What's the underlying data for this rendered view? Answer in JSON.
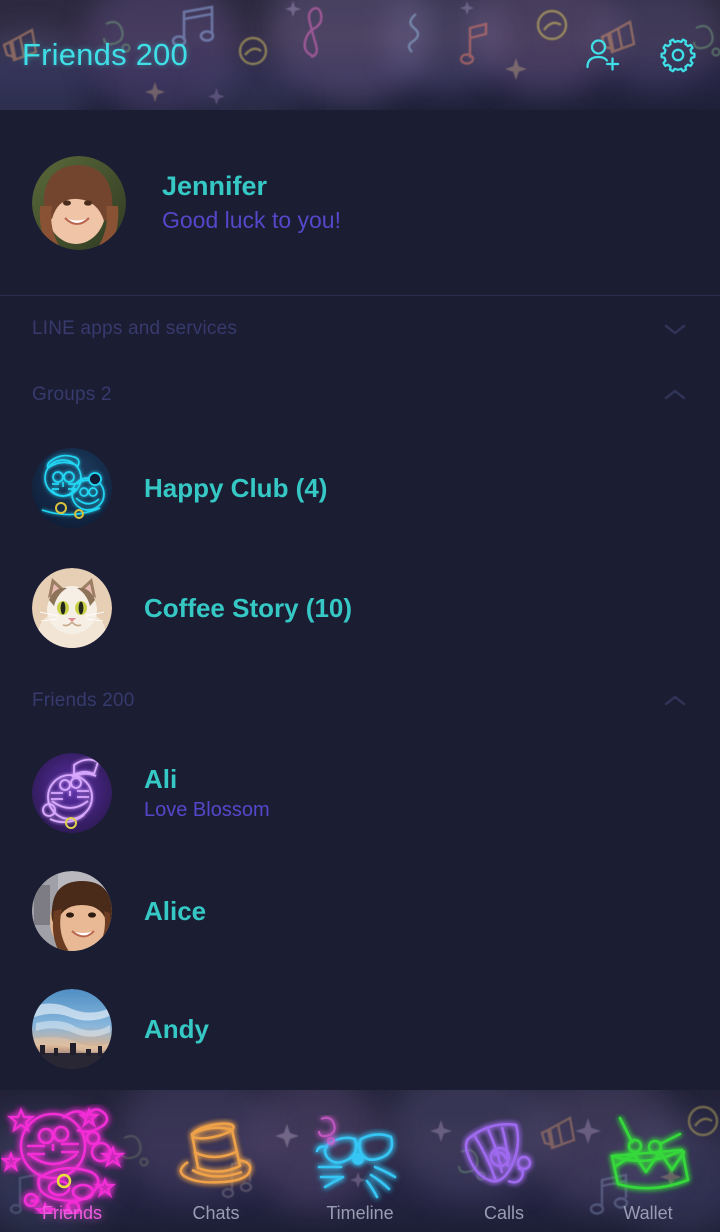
{
  "header": {
    "title": "Friends 200",
    "title_color": "#3fdfe7",
    "add_friend_icon": "person-add-icon",
    "settings_icon": "gear-icon"
  },
  "profile": {
    "name": "Jennifer",
    "status_message": "Good luck to you!",
    "avatar": "jennifer-photo-avatar",
    "name_color": "#35c8c4",
    "status_color": "#5248c9"
  },
  "sections": [
    {
      "label": "LINE apps and services",
      "chevron": "chevron-down-icon",
      "expanded": false
    },
    {
      "label": "Groups 2",
      "chevron": "chevron-up-icon",
      "expanded": true
    },
    {
      "label": "Friends 200",
      "chevron": "chevron-up-icon",
      "expanded": true
    }
  ],
  "groups": [
    {
      "name": "Happy Club (4)",
      "avatar": "neon-doraemon-blue-avatar"
    },
    {
      "name": "Coffee Story (10)",
      "avatar": "cat-photo-avatar"
    }
  ],
  "friends": [
    {
      "name": "Ali",
      "status_message": "Love Blossom",
      "avatar": "neon-doraemon-purple-tophat-avatar"
    },
    {
      "name": "Alice",
      "status_message": "",
      "avatar": "alice-photo-avatar"
    },
    {
      "name": "Andy",
      "status_message": "",
      "avatar": "sky-photo-avatar"
    }
  ],
  "bottom_nav": {
    "active": "Friends",
    "active_color": "#f15ae0",
    "inactive_color": "#9a9cb4",
    "items": [
      {
        "label": "Friends",
        "icon": "neon-doraemon-pink-icon",
        "color": "#f32fd6"
      },
      {
        "label": "Chats",
        "icon": "neon-top-hat-icon",
        "color": "#f0a24a"
      },
      {
        "label": "Timeline",
        "icon": "neon-glasses-whiskers-icon",
        "color": "#35c6f5"
      },
      {
        "label": "Calls",
        "icon": "neon-party-horn-icon",
        "color": "#a06bf0"
      },
      {
        "label": "Wallet",
        "icon": "neon-drum-icon",
        "color": "#36d93a"
      }
    ]
  },
  "theme": {
    "background": "#1b1d33",
    "divider": "#2a2d4d",
    "section_label_color": "#363a6c"
  }
}
